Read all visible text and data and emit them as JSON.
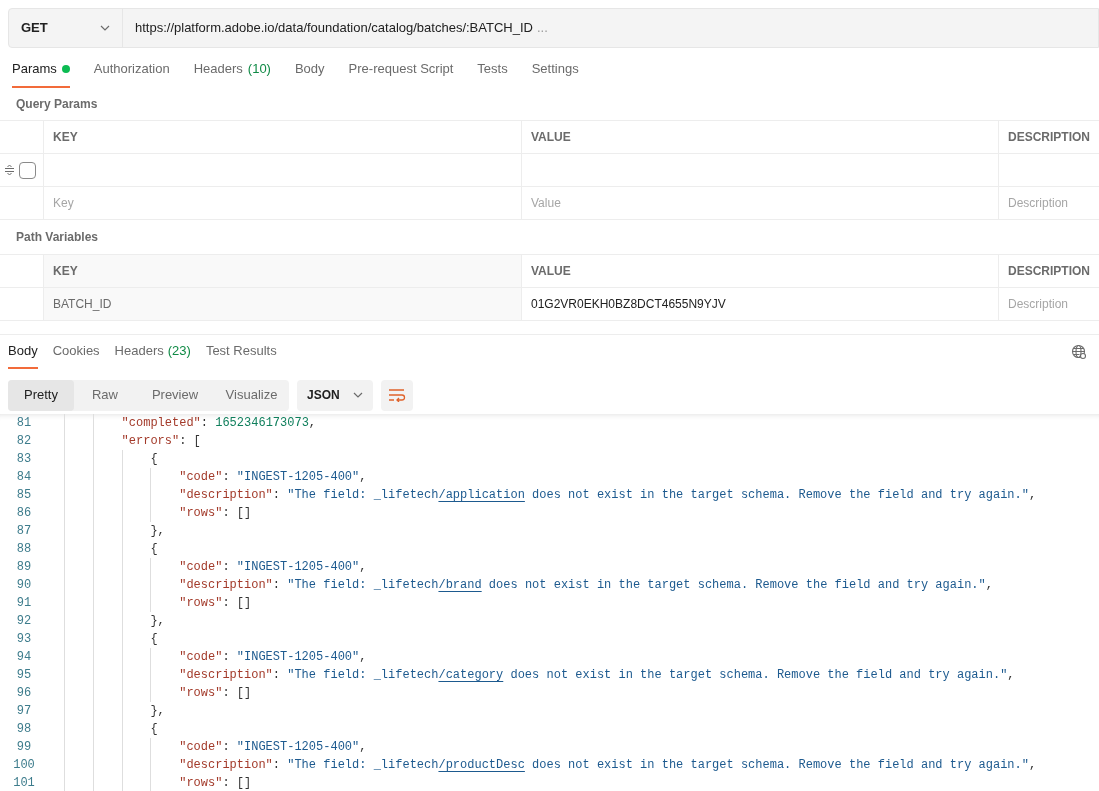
{
  "request": {
    "method": "GET",
    "url": "https://platform.adobe.io/data/foundation/catalog/batches/:BATCH_ID",
    "url_overflow": "..."
  },
  "request_tabs": [
    {
      "label": "Params",
      "indicator": true,
      "selected": true
    },
    {
      "label": "Authorization",
      "indicator": false,
      "selected": false
    },
    {
      "label": "Headers",
      "count": "(10)",
      "indicator": false,
      "selected": false
    },
    {
      "label": "Body",
      "indicator": false,
      "selected": false
    },
    {
      "label": "Pre-request Script",
      "indicator": false,
      "selected": false
    },
    {
      "label": "Tests",
      "indicator": false,
      "selected": false
    },
    {
      "label": "Settings",
      "indicator": false,
      "selected": false
    }
  ],
  "query_params": {
    "title": "Query Params",
    "columns": [
      "KEY",
      "VALUE",
      "DESCRIPTION"
    ],
    "rows": [
      {
        "checked": false
      }
    ],
    "new_row": [
      {
        "placeholder": "Key"
      },
      {
        "placeholder": "Value"
      },
      {
        "placeholder": "Description"
      }
    ]
  },
  "path_variables": {
    "title": "Path Variables",
    "columns": [
      "KEY",
      "VALUE",
      "DESCRIPTION"
    ],
    "rows": [
      {
        "key": "BATCH_ID",
        "value": "01G2VR0EKH0BZ8DCT4655N9YJV",
        "description": {
          "placeholder": "Description"
        }
      }
    ]
  },
  "response_tabs": [
    {
      "label": "Body",
      "selected": true
    },
    {
      "label": "Cookies",
      "selected": false
    },
    {
      "label": "Headers",
      "count": "(23)",
      "selected": false
    },
    {
      "label": "Test Results",
      "selected": false
    }
  ],
  "view_modes": [
    {
      "label": "Pretty",
      "selected": true
    },
    {
      "label": "Raw",
      "selected": false
    },
    {
      "label": "Preview",
      "selected": false
    },
    {
      "label": "Visualize",
      "selected": false
    }
  ],
  "format": "JSON",
  "code_lines": [
    {
      "number": "81",
      "tokens": [
        {
          "kind": "key",
          "text": "\"completed\""
        },
        {
          "kind": "punct",
          "text": ": "
        },
        {
          "kind": "number",
          "text": "1652346173073"
        },
        {
          "kind": "punct",
          "text": ","
        }
      ]
    },
    {
      "number": "82",
      "tokens": [
        {
          "kind": "key",
          "text": "\"errors\""
        },
        {
          "kind": "punct",
          "text": ": ["
        }
      ],
      "children": [
        {
          "number": "83",
          "tokens": [
            {
              "kind": "punct",
              "text": "{"
            }
          ],
          "children": [
            {
              "number": "84",
              "tokens": [
                {
                  "kind": "key",
                  "text": "\"code\""
                },
                {
                  "kind": "punct",
                  "text": ": "
                },
                {
                  "kind": "string",
                  "text": "\"INGEST-1205-400\""
                },
                {
                  "kind": "punct",
                  "text": ","
                }
              ]
            },
            {
              "number": "85",
              "tokens": [
                {
                  "kind": "key",
                  "text": "\"description\""
                },
                {
                  "kind": "punct",
                  "text": ": "
                },
                {
                  "kind": "string",
                  "text": "\"The field: _lifetech"
                },
                {
                  "kind": "link",
                  "text": "/application"
                },
                {
                  "kind": "string",
                  "text": " does not exist in the target schema. Remove the field and try again.\""
                },
                {
                  "kind": "punct",
                  "text": ","
                }
              ]
            },
            {
              "number": "86",
              "tokens": [
                {
                  "kind": "key",
                  "text": "\"rows\""
                },
                {
                  "kind": "punct",
                  "text": ": []"
                }
              ]
            }
          ]
        },
        {
          "number": "87",
          "tokens": [
            {
              "kind": "punct",
              "text": "},"
            }
          ]
        },
        {
          "number": "88",
          "tokens": [
            {
              "kind": "punct",
              "text": "{"
            }
          ],
          "children": [
            {
              "number": "89",
              "tokens": [
                {
                  "kind": "key",
                  "text": "\"code\""
                },
                {
                  "kind": "punct",
                  "text": ": "
                },
                {
                  "kind": "string",
                  "text": "\"INGEST-1205-400\""
                },
                {
                  "kind": "punct",
                  "text": ","
                }
              ]
            },
            {
              "number": "90",
              "tokens": [
                {
                  "kind": "key",
                  "text": "\"description\""
                },
                {
                  "kind": "punct",
                  "text": ": "
                },
                {
                  "kind": "string",
                  "text": "\"The field: _lifetech"
                },
                {
                  "kind": "link",
                  "text": "/brand"
                },
                {
                  "kind": "string",
                  "text": " does not exist in the target schema. Remove the field and try again.\""
                },
                {
                  "kind": "punct",
                  "text": ","
                }
              ]
            },
            {
              "number": "91",
              "tokens": [
                {
                  "kind": "key",
                  "text": "\"rows\""
                },
                {
                  "kind": "punct",
                  "text": ": []"
                }
              ]
            }
          ]
        },
        {
          "number": "92",
          "tokens": [
            {
              "kind": "punct",
              "text": "},"
            }
          ]
        },
        {
          "number": "93",
          "tokens": [
            {
              "kind": "punct",
              "text": "{"
            }
          ],
          "children": [
            {
              "number": "94",
              "tokens": [
                {
                  "kind": "key",
                  "text": "\"code\""
                },
                {
                  "kind": "punct",
                  "text": ": "
                },
                {
                  "kind": "string",
                  "text": "\"INGEST-1205-400\""
                },
                {
                  "kind": "punct",
                  "text": ","
                }
              ]
            },
            {
              "number": "95",
              "tokens": [
                {
                  "kind": "key",
                  "text": "\"description\""
                },
                {
                  "kind": "punct",
                  "text": ": "
                },
                {
                  "kind": "string",
                  "text": "\"The field: _lifetech"
                },
                {
                  "kind": "link",
                  "text": "/category"
                },
                {
                  "kind": "string",
                  "text": " does not exist in the target schema. Remove the field and try again.\""
                },
                {
                  "kind": "punct",
                  "text": ","
                }
              ]
            },
            {
              "number": "96",
              "tokens": [
                {
                  "kind": "key",
                  "text": "\"rows\""
                },
                {
                  "kind": "punct",
                  "text": ": []"
                }
              ]
            }
          ]
        },
        {
          "number": "97",
          "tokens": [
            {
              "kind": "punct",
              "text": "},"
            }
          ]
        },
        {
          "number": "98",
          "tokens": [
            {
              "kind": "punct",
              "text": "{"
            }
          ],
          "children": [
            {
              "number": "99",
              "tokens": [
                {
                  "kind": "key",
                  "text": "\"code\""
                },
                {
                  "kind": "punct",
                  "text": ": "
                },
                {
                  "kind": "string",
                  "text": "\"INGEST-1205-400\""
                },
                {
                  "kind": "punct",
                  "text": ","
                }
              ]
            },
            {
              "number": "100",
              "tokens": [
                {
                  "kind": "key",
                  "text": "\"description\""
                },
                {
                  "kind": "punct",
                  "text": ": "
                },
                {
                  "kind": "string",
                  "text": "\"The field: _lifetech"
                },
                {
                  "kind": "link",
                  "text": "/productDesc"
                },
                {
                  "kind": "string",
                  "text": " does not exist in the target schema. Remove the field and try again.\""
                },
                {
                  "kind": "punct",
                  "text": ","
                }
              ]
            },
            {
              "number": "101",
              "tokens": [
                {
                  "kind": "key",
                  "text": "\"rows\""
                },
                {
                  "kind": "punct",
                  "text": ": []"
                }
              ]
            }
          ]
        }
      ]
    }
  ]
}
